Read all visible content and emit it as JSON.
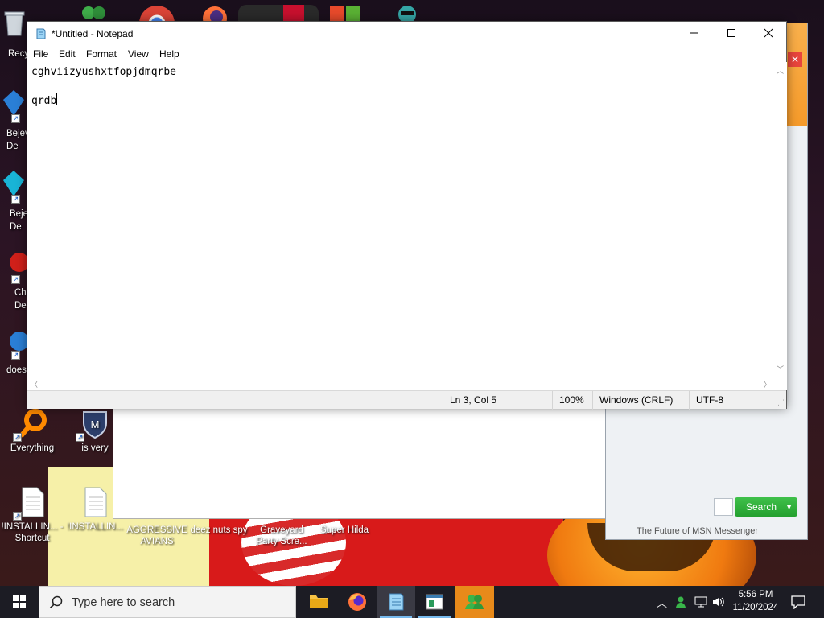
{
  "desktop": {
    "icons": [
      {
        "label": "Recy",
        "name": "recycle-bin-desktop-icon"
      },
      {
        "label": "Bejev De",
        "name": "bejeweled-desktop-icon-1"
      },
      {
        "label": "Beje De",
        "name": "bejeweled-desktop-icon-2"
      },
      {
        "label": "Ch De",
        "name": "chrome-like-desktop-icon"
      },
      {
        "label": "does",
        "name": "does-desktop-icon"
      },
      {
        "label": "Everything",
        "name": "everything-desktop-icon"
      },
      {
        "label": "is very",
        "name": "is-very-desktop-icon"
      },
      {
        "label": "!INSTALLIN... - Shortcut",
        "name": "installing-shortcut-desktop-icon"
      },
      {
        "label": "!INSTALLIN...",
        "name": "installing-file-desktop-icon"
      },
      {
        "label": "AGGRESSIVE AVIANS",
        "name": "aggressive-avians-desktop-icon"
      },
      {
        "label": "deez nuts spy",
        "name": "deez-nuts-spy-desktop-icon"
      },
      {
        "label": "Graveyard Party Scre...",
        "name": "graveyard-party-desktop-icon"
      },
      {
        "label": "Super Hilda",
        "name": "super-hilda-desktop-icon"
      }
    ]
  },
  "msn": {
    "search_label": "Search",
    "footer": "The Future of MSN Messenger"
  },
  "notepad": {
    "title": "*Untitled - Notepad",
    "menu": [
      "File",
      "Edit",
      "Format",
      "View",
      "Help"
    ],
    "lines": [
      "cghviizyushxtfopjdmqrbe",
      "",
      "qrdb"
    ],
    "status": {
      "position": "Ln 3, Col 5",
      "zoom": "100%",
      "line_ending": "Windows (CRLF)",
      "encoding": "UTF-8"
    }
  },
  "taskbar": {
    "search_placeholder": "Type here to search",
    "clock_time": "5:56 PM",
    "clock_date": "11/20/2024"
  },
  "colors": {
    "accent": "#76b9ed",
    "msn_orange": "#f59a2a",
    "msn_green": "#24a02f"
  }
}
